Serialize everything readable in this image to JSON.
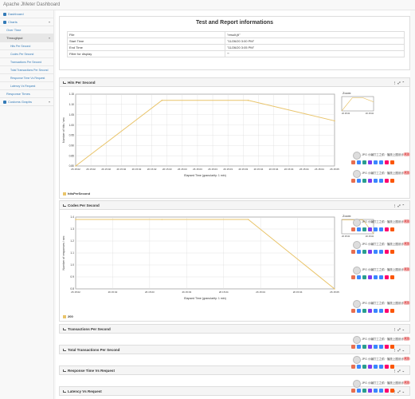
{
  "app": {
    "title": "Apache JMeter Dashboard"
  },
  "sidebar": {
    "items": [
      {
        "label": "Dashboard",
        "icon": "dashboard-icon"
      },
      {
        "label": "Charts",
        "icon": "chart-icon",
        "expanded": true
      },
      {
        "label": "Over Time"
      },
      {
        "label": "Throughput",
        "active": true
      },
      {
        "label": "Hits Per Second"
      },
      {
        "label": "Codes Per Second"
      },
      {
        "label": "Transactions Per Second"
      },
      {
        "label": "Total Transactions Per Second"
      },
      {
        "label": "Response Time Vs Request"
      },
      {
        "label": "Latency Vs Request"
      },
      {
        "label": "Response Times"
      },
      {
        "label": "Customs Graphs",
        "icon": "chart-icon"
      }
    ]
  },
  "info_panel": {
    "title": "Test and Report informations",
    "rows": [
      {
        "key": "File",
        "value": "\"result.jtl\""
      },
      {
        "key": "Start Time",
        "value": "\"11/26/20 3:00 PM\""
      },
      {
        "key": "End Time",
        "value": "\"11/26/20 3:05 PM\""
      },
      {
        "key": "Filter for display",
        "value": "\"\""
      }
    ]
  },
  "hits_panel": {
    "title": "Hits Per Second",
    "ylabel": "Number of hits / sec",
    "xlabel": "Elapsed Time (granularity: 1 min)",
    "legend": "hitsPerSecond",
    "zoom_label": "Zoom:"
  },
  "codes_panel": {
    "title": "Codes Per Second",
    "ylabel": "Number of responses / sec",
    "xlabel": "Elapsed Time (granularity: 1 min)",
    "legend": "200",
    "zoom_label": "Zoom:"
  },
  "collapsed_panels": [
    {
      "title": "Transactions Per Second"
    },
    {
      "title": "Total Transactions Per Second"
    },
    {
      "title": "Response Time Vs Request"
    },
    {
      "title": "Latency Vs Request"
    }
  ],
  "overlay": {
    "text": "JPG 小编打工之前 · 播放上图设计",
    "pill": "关注"
  },
  "chart_data": [
    {
      "type": "line",
      "title": "Hits Per Second",
      "xlabel": "Elapsed Time (granularity: 1 min)",
      "ylabel": "Number of hits / sec",
      "x": [
        "26 15:02",
        "26 15:03",
        "26 15:04",
        "26 15:05"
      ],
      "x_ticks": [
        "26 15:02",
        "26 15:02",
        "26 15:02",
        "26 15:02",
        "26 15:02",
        "26 15:02",
        "26 15:03",
        "26 15:03",
        "26 15:03",
        "26 15:03",
        "26 15:03",
        "26 15:03",
        "26 15:04",
        "26 15:04",
        "26 15:04",
        "26 15:04",
        "26 15:04",
        "26 15:05"
      ],
      "y_ticks": [
        "0.80",
        "0.85",
        "0.90",
        "0.95",
        "1.00",
        "1.05",
        "1.10",
        "1.15"
      ],
      "series": [
        {
          "name": "hitsPerSecond",
          "values": [
            0.8,
            1.12,
            1.12,
            1.02
          ]
        }
      ],
      "ylim": [
        0.8,
        1.15
      ],
      "color": "#e9c46a"
    },
    {
      "type": "line",
      "title": "Codes Per Second",
      "xlabel": "Elapsed Time (granularity: 1 min)",
      "ylabel": "Number of responses / sec",
      "x": [
        "26 15:02",
        "26 15:03",
        "26 15:04",
        "26 15:05"
      ],
      "x_ticks": [
        "26 15:02",
        "26 15:02",
        "26 15:03",
        "26 15:03",
        "26 15:04",
        "26 15:04",
        "26 15:04",
        "26 15:05"
      ],
      "y_ticks": [
        "0.8",
        "0.9",
        "1.0",
        "1.1",
        "1.2",
        "1.3",
        "1.4"
      ],
      "series": [
        {
          "name": "200",
          "values": [
            1.38,
            1.38,
            1.38,
            0.8
          ]
        }
      ],
      "ylim": [
        0.8,
        1.4
      ],
      "color": "#e9c46a"
    }
  ]
}
